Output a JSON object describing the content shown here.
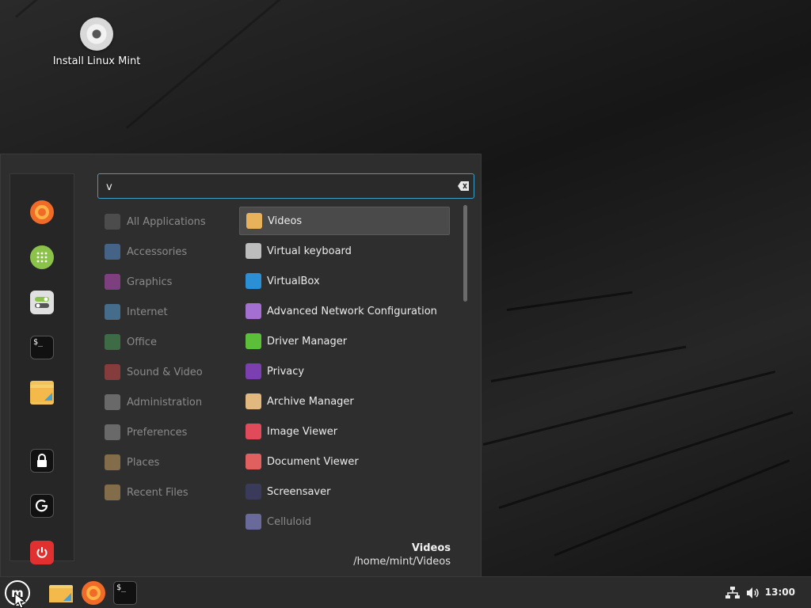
{
  "desktop": {
    "icon_label": "Install Linux Mint"
  },
  "search": {
    "value": "v"
  },
  "categories": [
    {
      "label": "All Applications",
      "icon": "grid-icon",
      "color": "#666666"
    },
    {
      "label": "Accessories",
      "icon": "scissors-icon",
      "color": "#5a8fd0"
    },
    {
      "label": "Graphics",
      "icon": "palette-icon",
      "color": "#c04fc0"
    },
    {
      "label": "Internet",
      "icon": "cloud-icon",
      "color": "#5aa0d8"
    },
    {
      "label": "Office",
      "icon": "document-icon",
      "color": "#4a9e5a"
    },
    {
      "label": "Sound & Video",
      "icon": "play-icon",
      "color": "#d04848"
    },
    {
      "label": "Administration",
      "icon": "toggle-icon",
      "color": "#9a9a9a"
    },
    {
      "label": "Preferences",
      "icon": "toggle-icon",
      "color": "#9a9a9a"
    },
    {
      "label": "Places",
      "icon": "folder-icon",
      "color": "#c8a060"
    },
    {
      "label": "Recent Files",
      "icon": "folder-clock-icon",
      "color": "#c8a060"
    }
  ],
  "apps": [
    {
      "label": "Videos",
      "icon": "video-folder-icon",
      "color": "#e8b25a"
    },
    {
      "label": "Virtual keyboard",
      "icon": "keyboard-icon",
      "color": "#bdbdbd"
    },
    {
      "label": "VirtualBox",
      "icon": "virtualbox-icon",
      "color": "#2b8fd6"
    },
    {
      "label": "Advanced Network Configuration",
      "icon": "network-icon",
      "color": "#a36fd0"
    },
    {
      "label": "Driver Manager",
      "icon": "chip-icon",
      "color": "#5cbf3a"
    },
    {
      "label": "Privacy",
      "icon": "mask-icon",
      "color": "#7b3fb0"
    },
    {
      "label": "Archive Manager",
      "icon": "archive-icon",
      "color": "#e0b880"
    },
    {
      "label": "Image Viewer",
      "icon": "image-icon",
      "color": "#e04a5a"
    },
    {
      "label": "Document Viewer",
      "icon": "glasses-icon",
      "color": "#e06060"
    },
    {
      "label": "Screensaver",
      "icon": "moon-icon",
      "color": "#3a3a5a"
    },
    {
      "label": "Celluloid",
      "icon": "celluloid-icon",
      "color": "#6a6a9a"
    }
  ],
  "info": {
    "title": "Videos",
    "path": "/home/mint/Videos"
  },
  "panel": {
    "clock": "13:00"
  },
  "colors": {
    "accent": "#3f9ec9",
    "firefox": "#f06a28",
    "power": "#e03030",
    "mint_green": "#8bc34a"
  }
}
